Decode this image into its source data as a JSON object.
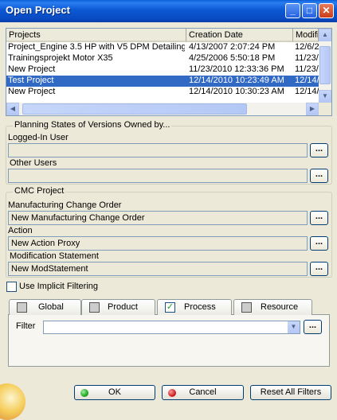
{
  "window": {
    "title": "Open Project",
    "minimize_icon": "minimize-icon",
    "maximize_icon": "maximize-icon",
    "close_icon": "close-icon"
  },
  "projects_table": {
    "columns": [
      "Projects",
      "Creation Date",
      "Modific"
    ],
    "rows": [
      {
        "project": "Project_Engine 3.5 HP with V5 DPM Detailing",
        "created": "4/13/2007 2:07:24 PM",
        "modified": "12/6/2"
      },
      {
        "project": "Trainingsprojekt Motor X35",
        "created": "4/25/2006 5:50:18 PM",
        "modified": "11/23/"
      },
      {
        "project": "New Project",
        "created": "11/23/2010 12:33:36 PM",
        "modified": "11/23/"
      },
      {
        "project": "Test Project",
        "created": "12/14/2010 10:23:49 AM",
        "modified": "12/14/"
      },
      {
        "project": "New Project",
        "created": "12/14/2010 10:30:23 AM",
        "modified": "12/14/"
      }
    ],
    "selected_index": 3
  },
  "planning_states": {
    "title": "Planning States of Versions Owned by...",
    "logged_in_user_label": "Logged-In User",
    "logged_in_user_value": "",
    "other_users_label": "Other Users",
    "other_users_value": "",
    "browse_label": "..."
  },
  "cmc_project": {
    "title": "CMC Project",
    "mco_label": "Manufacturing Change Order",
    "mco_value": "New Manufacturing Change Order",
    "action_label": "Action",
    "action_value": "New Action Proxy",
    "modification_label": "Modification Statement",
    "modification_value": "New ModStatement",
    "browse_label": "..."
  },
  "implicit_filtering": {
    "label": "Use Implicit Filtering",
    "checked": false
  },
  "tabs": [
    {
      "label": "Global",
      "checked": false
    },
    {
      "label": "Product",
      "checked": false
    },
    {
      "label": "Process",
      "checked": true
    },
    {
      "label": "Resource",
      "checked": false
    }
  ],
  "filter": {
    "label": "Filter",
    "value": "",
    "browse_label": "..."
  },
  "buttons": {
    "ok": "OK",
    "cancel": "Cancel",
    "reset": "Reset All Filters"
  },
  "colors": {
    "titlebar": "#0a58d4",
    "selection": "#316ac5",
    "ok_led": "#22a822",
    "cancel_led": "#d62020"
  }
}
